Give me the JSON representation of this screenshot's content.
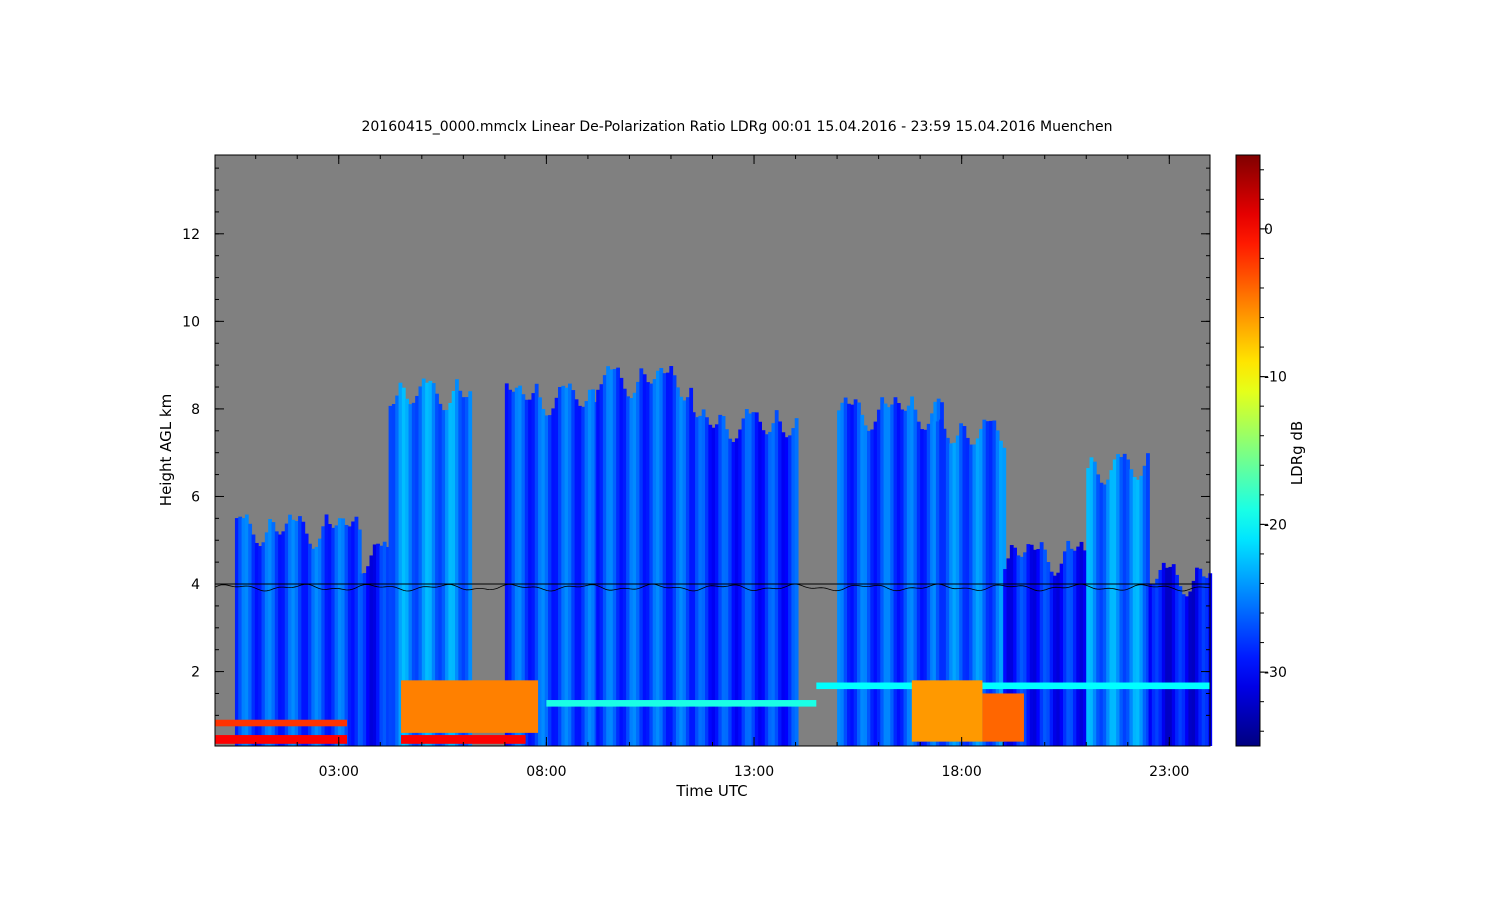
{
  "chart_data": {
    "type": "heatmap",
    "title": "20160415_0000.mmclx Linear De-Polarization Ratio LDRg   00:01 15.04.2016 - 23:59 15.04.2016 Muenchen",
    "xlabel": "Time UTC",
    "ylabel": "Height AGL km",
    "colorbar_label": "LDRg dB",
    "x_unit": "hours UTC",
    "xlim": [
      0.02,
      23.98
    ],
    "ylim": [
      0.3,
      13.8
    ],
    "x_ticks": [
      {
        "value": 3,
        "label": "03:00"
      },
      {
        "value": 8,
        "label": "08:00"
      },
      {
        "value": 13,
        "label": "13:00"
      },
      {
        "value": 18,
        "label": "18:00"
      },
      {
        "value": 23,
        "label": "23:00"
      }
    ],
    "y_ticks": [
      {
        "value": 2,
        "label": "2"
      },
      {
        "value": 4,
        "label": "4"
      },
      {
        "value": 6,
        "label": "6"
      },
      {
        "value": 8,
        "label": "8"
      },
      {
        "value": 10,
        "label": "10"
      },
      {
        "value": 12,
        "label": "12"
      }
    ],
    "colorbar": {
      "range": [
        -35,
        5
      ],
      "ticks": [
        {
          "value": 0,
          "label": "0"
        },
        {
          "value": -10,
          "label": "-10"
        },
        {
          "value": -20,
          "label": "-20"
        },
        {
          "value": -30,
          "label": "-30"
        }
      ],
      "colormap": "jet"
    },
    "background_color": "#808080",
    "melting_layer_height_km": 4.0,
    "cloud_regions": [
      {
        "t_start": 0.5,
        "t_end": 3.5,
        "h_top": 5.6,
        "ldr_db": -27
      },
      {
        "t_start": 3.5,
        "t_end": 4.5,
        "h_top": 5.0,
        "ldr_db": -29
      },
      {
        "t_start": 4.2,
        "t_end": 6.2,
        "h_top": 8.7,
        "ldr_db": -25
      },
      {
        "t_start": 7.0,
        "t_end": 9.2,
        "h_top": 8.6,
        "ldr_db": -27
      },
      {
        "t_start": 9.2,
        "t_end": 11.5,
        "h_top": 9.0,
        "ldr_db": -27
      },
      {
        "t_start": 11.5,
        "t_end": 14.0,
        "h_top": 8.0,
        "ldr_db": -28
      },
      {
        "t_start": 15.0,
        "t_end": 17.5,
        "h_top": 8.3,
        "ldr_db": -27
      },
      {
        "t_start": 17.3,
        "t_end": 19.0,
        "h_top": 7.8,
        "ldr_db": -26
      },
      {
        "t_start": 19.0,
        "t_end": 21.5,
        "h_top": 5.0,
        "ldr_db": -29
      },
      {
        "t_start": 21.0,
        "t_end": 22.5,
        "h_top": 7.0,
        "ldr_db": -25
      },
      {
        "t_start": 22.5,
        "t_end": 23.98,
        "h_top": 4.5,
        "ldr_db": -30
      }
    ],
    "low_level_features": [
      {
        "t_start": 0.02,
        "t_end": 3.2,
        "h_bottom": 0.35,
        "h_top": 0.55,
        "ldr_db": 0
      },
      {
        "t_start": 0.02,
        "t_end": 3.2,
        "h_bottom": 0.75,
        "h_top": 0.9,
        "ldr_db": -2
      },
      {
        "t_start": 4.5,
        "t_end": 7.5,
        "h_bottom": 0.35,
        "h_top": 0.55,
        "ldr_db": 0
      },
      {
        "t_start": 4.5,
        "t_end": 7.8,
        "h_bottom": 0.6,
        "h_top": 1.8,
        "ldr_db": -5
      },
      {
        "t_start": 8.0,
        "t_end": 14.5,
        "h_bottom": 1.2,
        "h_top": 1.35,
        "ldr_db": -19
      },
      {
        "t_start": 14.5,
        "t_end": 23.98,
        "h_bottom": 1.6,
        "h_top": 1.75,
        "ldr_db": -20
      },
      {
        "t_start": 16.8,
        "t_end": 18.5,
        "h_bottom": 0.4,
        "h_top": 1.8,
        "ldr_db": -6
      },
      {
        "t_start": 18.5,
        "t_end": 19.5,
        "h_bottom": 0.4,
        "h_top": 1.5,
        "ldr_db": -4
      }
    ]
  }
}
